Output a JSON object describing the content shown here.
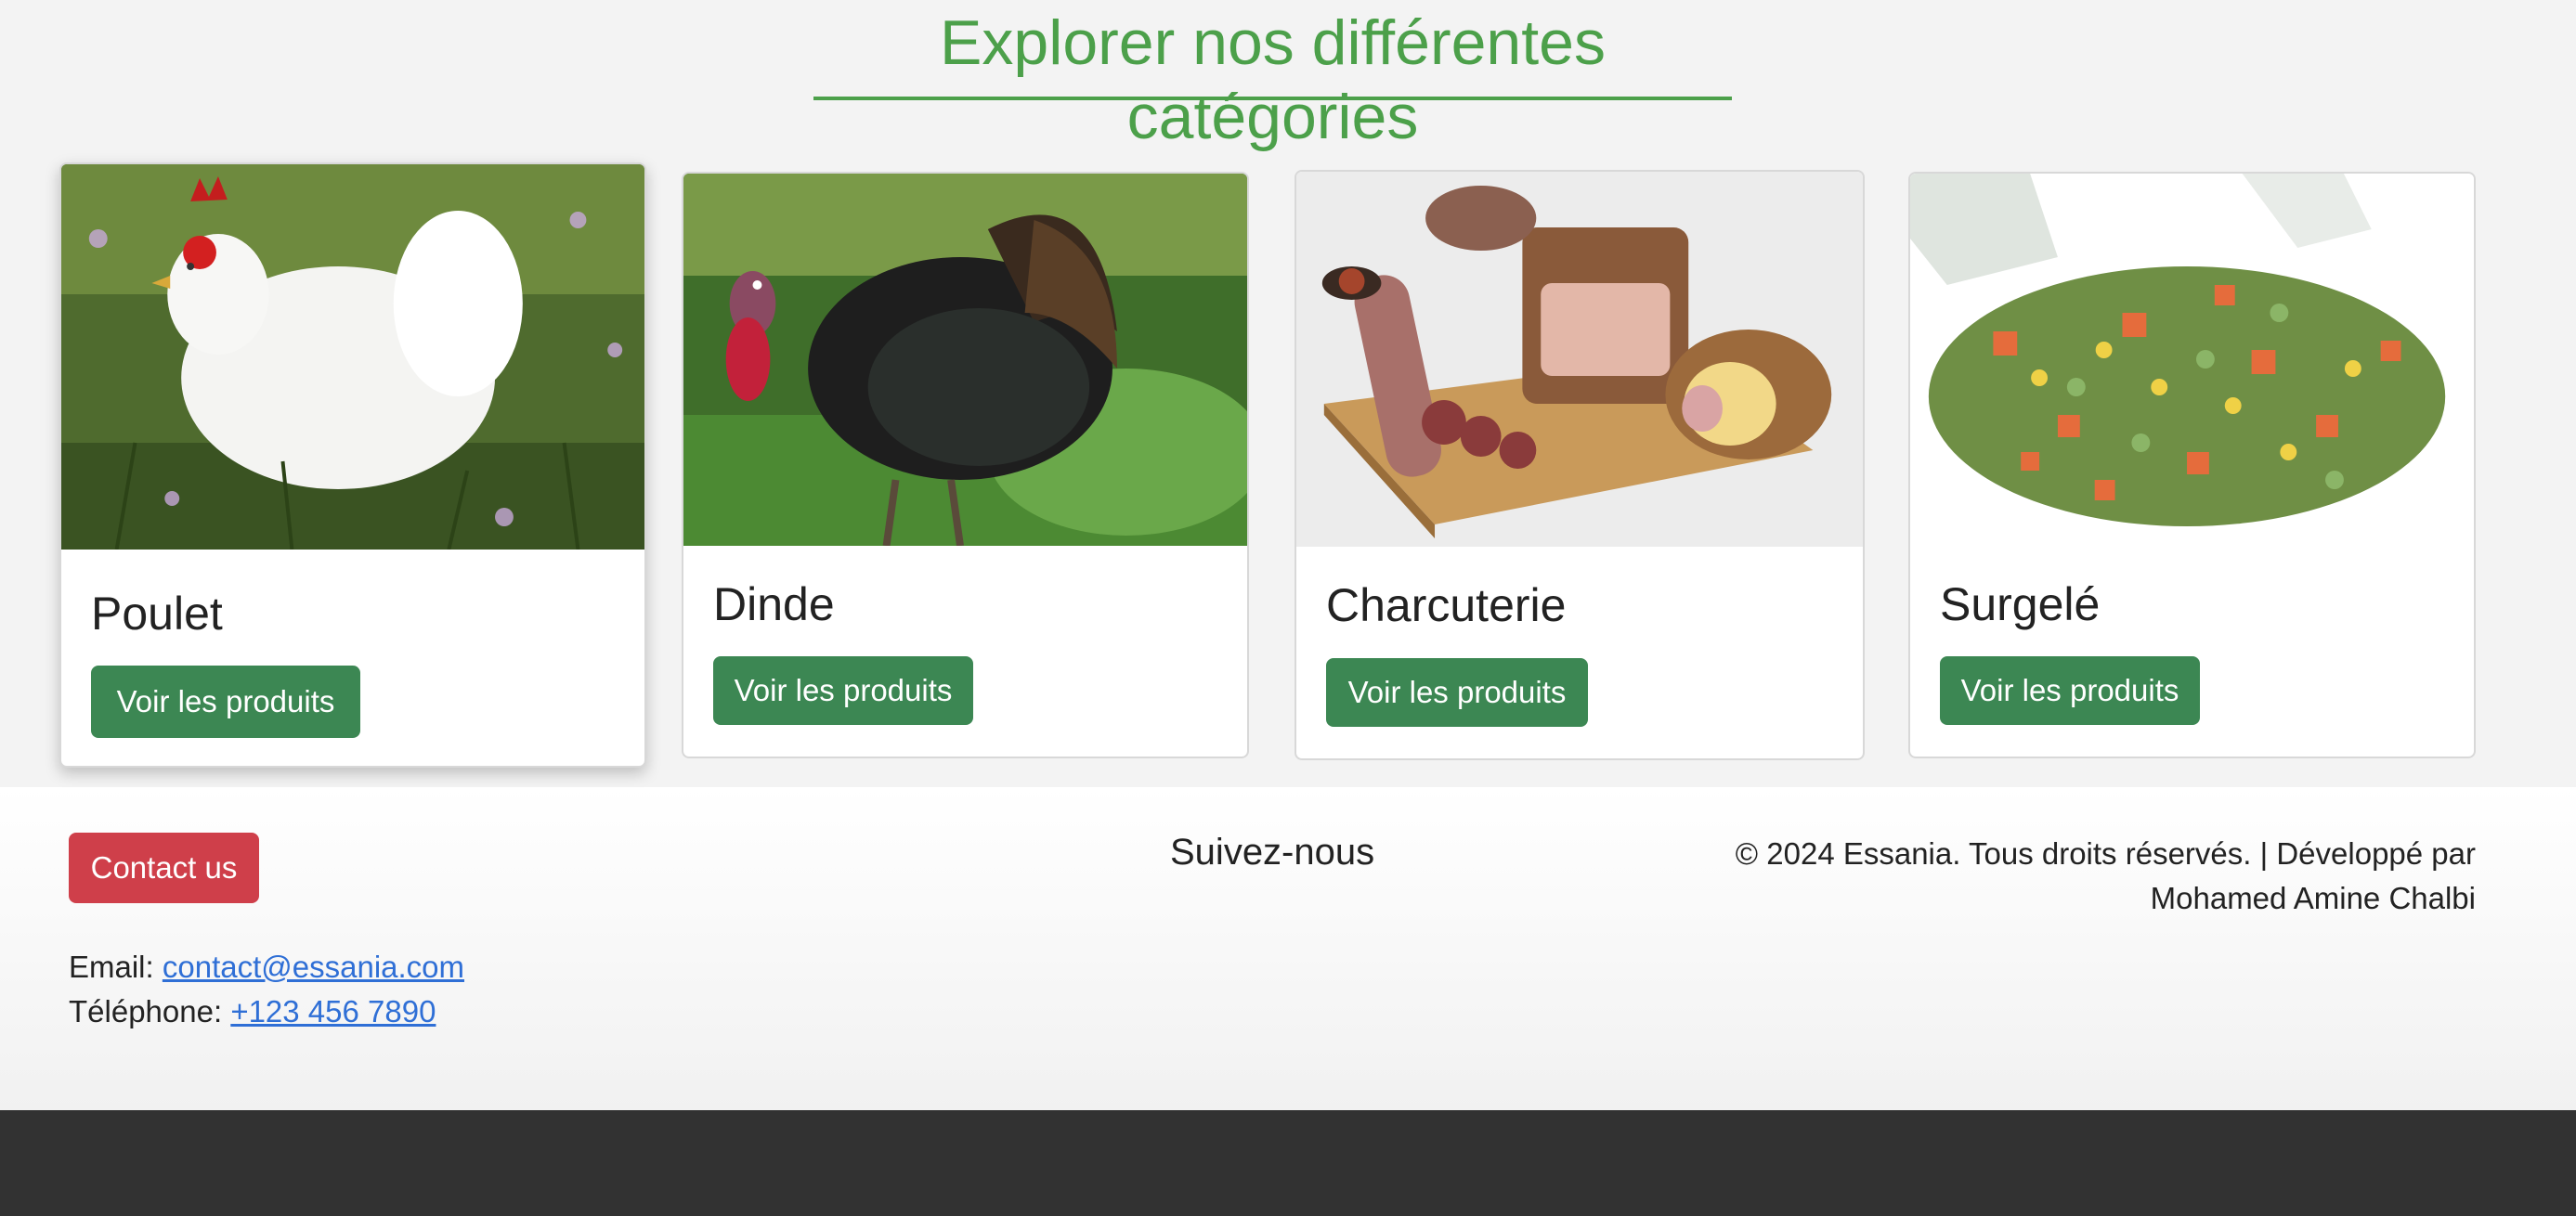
{
  "section": {
    "title": "Explorer nos différentes catégories"
  },
  "categories": [
    {
      "name": "Poulet",
      "button": "Voir les produits",
      "image_icon": "chicken-photo"
    },
    {
      "name": "Dinde",
      "button": "Voir les produits",
      "image_icon": "turkey-photo"
    },
    {
      "name": "Charcuterie",
      "button": "Voir les produits",
      "image_icon": "charcuterie-photo"
    },
    {
      "name": "Surgelé",
      "button": "Voir les produits",
      "image_icon": "frozen-vegetables-photo"
    }
  ],
  "footer": {
    "contact_button": "Contact us",
    "email_label": "Email:",
    "email_value": "contact@essania.com",
    "phone_label": "Téléphone:",
    "phone_value": "+123 456 7890",
    "follow_title": "Suivez-nous",
    "copyright_line1": "© 2024 Essania. Tous droits réservés. | Développé par",
    "copyright_line2": "Mohamed Amine Chalbi"
  },
  "colors": {
    "accent_green": "#4ca04a",
    "button_green": "#3c8753",
    "button_red": "#cf3f4a",
    "link_blue": "#2f6fd6",
    "bottom_bar": "#323232"
  }
}
